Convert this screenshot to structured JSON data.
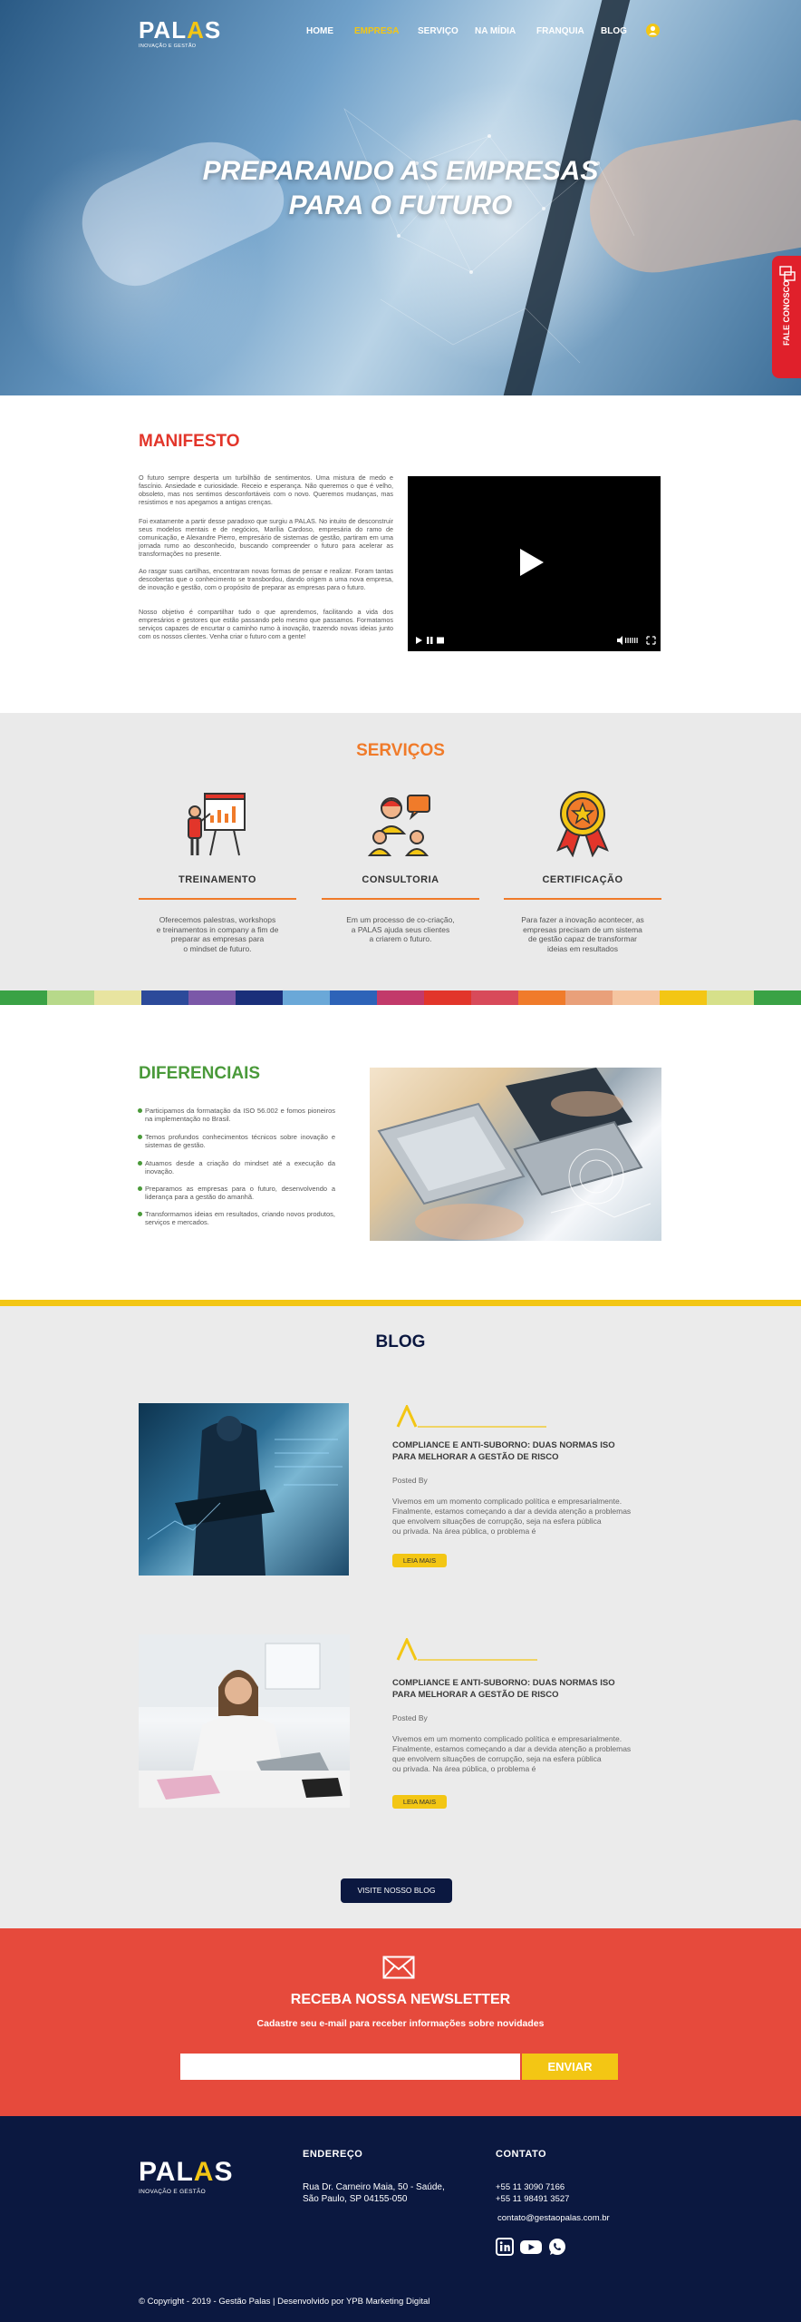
{
  "header": {
    "logo_pal": "PAL",
    "logo_a": "A",
    "logo_s": "S",
    "logo_tagline": "INOVAÇÃO E GESTÃO",
    "nav": [
      {
        "label": "HOME"
      },
      {
        "label": "EMPRESA"
      },
      {
        "label": "SERVIÇO"
      },
      {
        "label": "NA MÍDIA"
      },
      {
        "label": "FRANQUIA"
      },
      {
        "label": "BLOG"
      }
    ],
    "active_nav": "EMPRESA"
  },
  "hero": {
    "title_line1": "PREPARANDO AS EMPRESAS",
    "title_line2": "PARA O FUTURO"
  },
  "fale": {
    "label": "FALE CONOSCO"
  },
  "manifesto": {
    "title": "MANIFESTO",
    "paragraphs": [
      "O futuro sempre desperta um turbilhão de sentimentos. Uma mistura de medo e fascínio. Ansiedade e curiosidade. Receio e esperança. Não queremos o que é velho, obsoleto, mas nos sentimos desconfortáveis com o novo. Queremos mudanças, mas resistimos e nos apegamos a antigas crenças.",
      "Foi exatamente a partir desse paradoxo que surgiu a PALAS. No intuito de desconstruir seus modelos mentais e de negócios, Marília Cardoso, empresária do ramo de comunicação, e Alexandre Pierro, empresário de sistemas de gestão, partiram em uma jornada rumo ao desconhecido, buscando compreender o futuro para acelerar as transformações no presente.",
      "Ao rasgar suas cartilhas, encontraram novas formas de pensar e realizar. Foram tantas descobertas que o conhecimento se transbordou, dando origem a uma nova empresa, de inovação e gestão, com o propósito de preparar as empresas para o futuro.",
      "Nosso objetivo é compartilhar tudo o que aprendemos, facilitando a vida dos empresários e gestores que estão passando pelo mesmo que passamos. Formatamos serviços capazes de encurtar o caminho rumo à inovação, trazendo novas ideias junto com os nossos clientes. Venha criar o futuro com a gente!"
    ]
  },
  "servicos": {
    "title": "SERVIÇOS",
    "items": [
      {
        "title": "TREINAMENTO",
        "desc_line1": "Oferecemos palestras, workshops",
        "desc_line2": "e treinamentos in company a fim de",
        "desc_line3": "preparar as empresas para",
        "desc_line4": "o mindset de futuro.",
        "icon": "presentation-icon"
      },
      {
        "title": "CONSULTORIA",
        "desc_line1": "Em um processo de co-criação,",
        "desc_line2": "a PALAS ajuda seus clientes",
        "desc_line3": "a criarem o futuro.",
        "desc_line4": "",
        "icon": "team-icon"
      },
      {
        "title": "CERTIFICAÇÃO",
        "desc_line1": "Para fazer a inovação acontecer, as",
        "desc_line2": "empresas precisam de um sistema",
        "desc_line3": "de gestão capaz de transformar",
        "desc_line4": "ideias em resultados",
        "icon": "medal-icon"
      }
    ]
  },
  "diferenciais": {
    "title": "DIFERENCIAIS",
    "items": [
      "Participamos da formatação da ISO 56.002 e fomos pioneiros na implementação no Brasil.",
      "Temos profundos conhecimentos técnicos sobre inovação e sistemas de gestão.",
      "Atuamos desde a criação do mindset até a execução da inovação.",
      "Preparamos as empresas para o futuro, desenvolvendo a liderança para a gestão do amanhã.",
      "Transformamos ideias em resultados, criando novos produtos, serviços e mercados."
    ]
  },
  "blog": {
    "title": "BLOG",
    "posts": [
      {
        "title_line1": "COMPLIANCE E ANTI-SUBORNO: DUAS NORMAS ISO",
        "title_line2": "PARA MELHORAR A GESTÃO DE RISCO",
        "by": "Posted By",
        "excerpt_line1": "Vivemos em um momento complicado política e empresarialmente.",
        "excerpt_line2": "Finalmente, estamos começando a dar a devida atenção a problemas",
        "excerpt_line3": "que envolvem situações de corrupção, seja na esfera pública",
        "excerpt_line4": "ou privada. Na área  pública, o problema é",
        "button": "LEIA MAIS"
      },
      {
        "title_line1": "COMPLIANCE E ANTI-SUBORNO: DUAS NORMAS ISO",
        "title_line2": "PARA MELHORAR A GESTÃO DE RISCO",
        "by": "Posted By",
        "excerpt_line1": "Vivemos em um momento complicado política e empresarialmente.",
        "excerpt_line2": "Finalmente, estamos começando a dar a devida atenção a problemas",
        "excerpt_line3": "que envolvem situações de corrupção, seja na esfera pública",
        "excerpt_line4": "ou privada. Na área  pública, o problema é",
        "button": "LEIA MAIS"
      }
    ],
    "visit_button": "VISITE NOSSO BLOG"
  },
  "newsletter": {
    "title": "RECEBA NOSSA NEWSLETTER",
    "subtitle": "Cadastre seu e-mail para receber informações sobre novidades",
    "input_value": "",
    "button": "ENVIAR"
  },
  "footer": {
    "logo_tagline": "INOVAÇÃO E GESTÃO",
    "address_title": "ENDEREÇO",
    "address_line1": "Rua Dr. Carneiro Maia, 50 - Saúde,",
    "address_line2": "São Paulo, SP 04155-050",
    "contact_title": "CONTATO",
    "phone1": "+55 11 3090 7166",
    "phone2": "+55 11 98491 3527",
    "email": "contato@gestaopalas.com.br",
    "social": [
      "linkedin-icon",
      "youtube-icon",
      "whatsapp-icon"
    ],
    "copyright": "© Copyright - 2019 - Gestão Palas | Desenvolvido por YPB Marketing Digital"
  },
  "colors": {
    "accent_yellow": "#f3c614",
    "manifesto_red": "#e2352a",
    "servicos_orange": "#f07b2a",
    "diferenciais_green": "#4a9a3a",
    "navy": "#0b1840",
    "newsletter_red": "#e64a3c"
  }
}
